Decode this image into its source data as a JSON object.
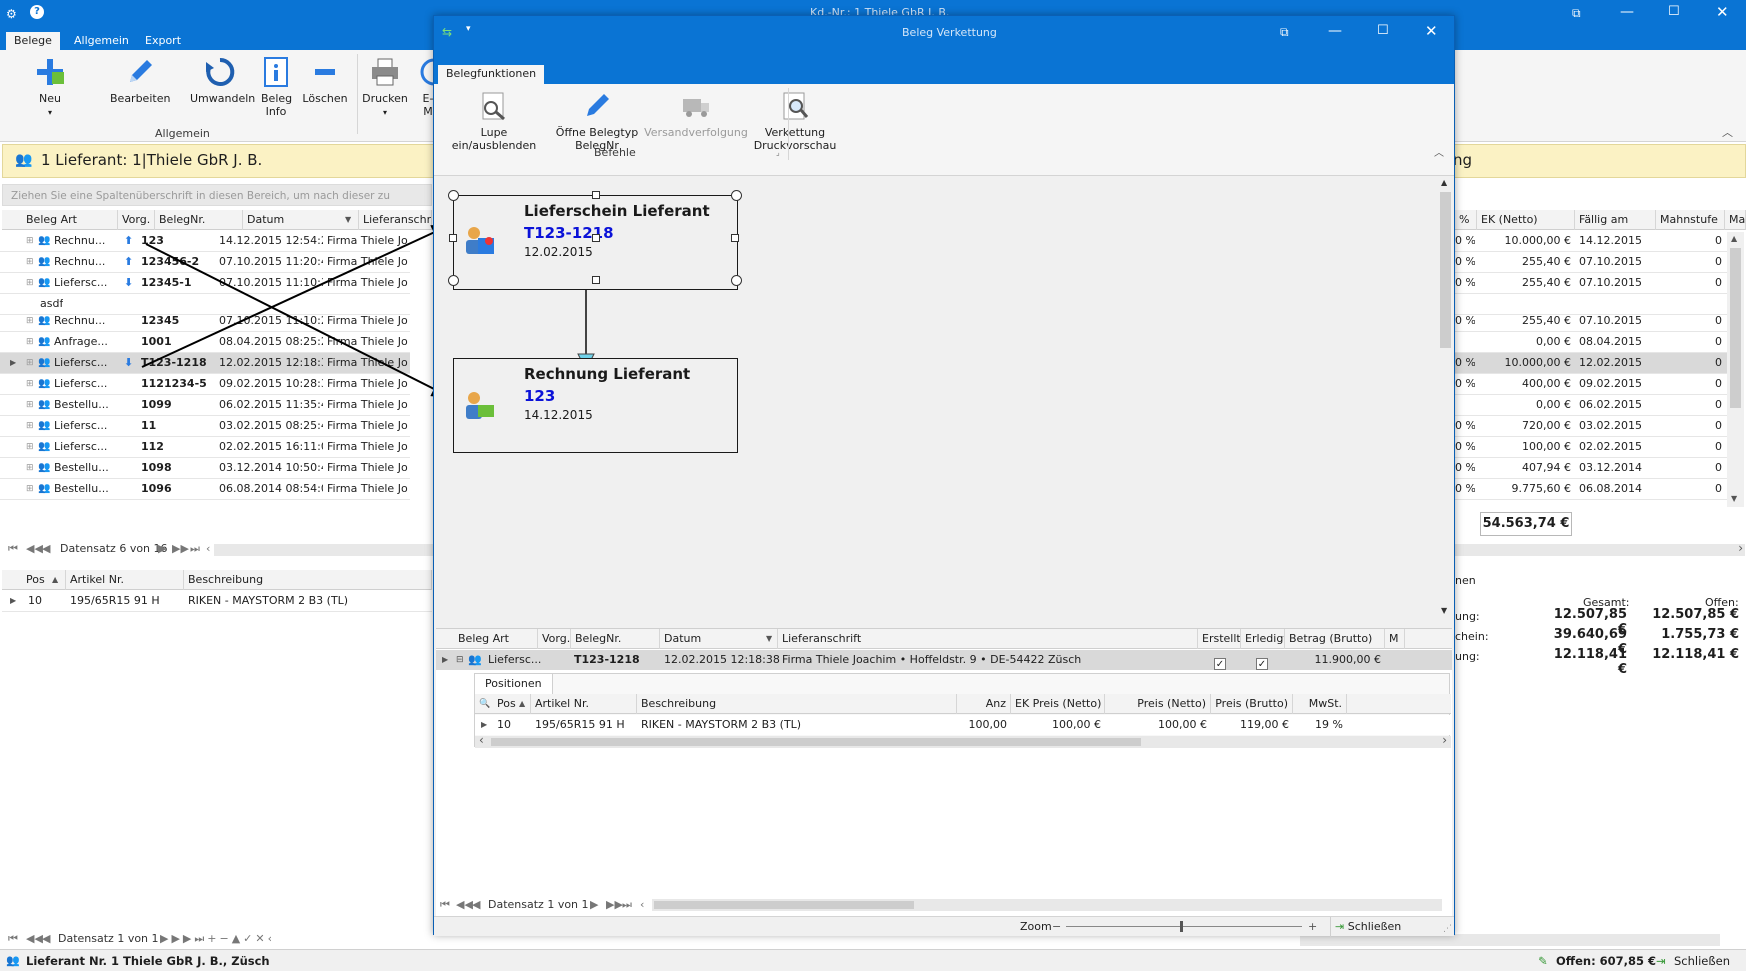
{
  "app": {
    "title": "Kd.-Nr.: 1 Thiele GbR J. B.",
    "tabs": [
      "Belege",
      "Allgemein",
      "Export"
    ],
    "ribbon": {
      "buttons": [
        "Neu",
        "Bearbeiten",
        "Umwandeln",
        "Beleg Info",
        "Löschen",
        "Drucken",
        "E-M"
      ],
      "group_label": "Allgemein"
    },
    "header_title": "1 Lieferant: 1|Thiele GbR J. B.",
    "header_right_fragment": "ng",
    "group_hint": "Ziehen Sie eine Spaltenüberschrift in diesen Bereich, um nach dieser zu gruppieren",
    "grid": {
      "columns": [
        "Beleg Art",
        "Vorg.",
        "BelegNr.",
        "Datum",
        "Lieferanschrift"
      ],
      "right_columns": [
        "%",
        "EK (Netto)",
        "Fällig am",
        "Mahnstufe",
        "Mah"
      ],
      "rows": [
        {
          "art": "Rechnu...",
          "vorg": "up",
          "nr": "123",
          "datum": "14.12.2015 12:54:25",
          "anschrift": "Firma Thiele Jo",
          "pct": "0 %",
          "ek": "10.000,00 €",
          "faellig": "14.12.2015",
          "mahn": "0"
        },
        {
          "art": "Rechnu...",
          "vorg": "up",
          "nr": "123456-2",
          "datum": "07.10.2015 11:20:40",
          "anschrift": "Firma Thiele Jo",
          "pct": "0 %",
          "ek": "255,40 €",
          "faellig": "07.10.2015",
          "mahn": "0"
        },
        {
          "art": "Liefersc...",
          "vorg": "down",
          "nr": "12345-1",
          "datum": "07.10.2015 11:10:32",
          "anschrift": "Firma Thiele Jo",
          "pct": "0 %",
          "ek": "255,40 €",
          "faellig": "07.10.2015",
          "mahn": "0"
        },
        {
          "art": "asdf",
          "vorg": "",
          "nr": "",
          "datum": "",
          "anschrift": "",
          "pct": "",
          "ek": "",
          "faellig": "",
          "mahn": "",
          "note": true
        },
        {
          "art": "Rechnu...",
          "vorg": "",
          "nr": "12345",
          "datum": "07.10.2015 11:10:20",
          "anschrift": "Firma Thiele Jo",
          "pct": "0 %",
          "ek": "255,40 €",
          "faellig": "07.10.2015",
          "mahn": "0"
        },
        {
          "art": "Anfrage...",
          "vorg": "",
          "nr": "1001",
          "datum": "08.04.2015 08:25:25",
          "anschrift": "Firma Thiele Jo",
          "pct": "",
          "ek": "0,00 €",
          "faellig": "08.04.2015",
          "mahn": "0"
        },
        {
          "art": "Liefersc...",
          "vorg": "down",
          "nr": "T123-1218",
          "datum": "12.02.2015 12:18:38",
          "anschrift": "Firma Thiele Jo",
          "pct": "0 %",
          "ek": "10.000,00 €",
          "faellig": "12.02.2015",
          "mahn": "0",
          "selected": true
        },
        {
          "art": "Liefersc...",
          "vorg": "",
          "nr": "1121234-5",
          "datum": "09.02.2015 10:28:34",
          "anschrift": "Firma Thiele Jo",
          "pct": "0 %",
          "ek": "400,00 €",
          "faellig": "09.02.2015",
          "mahn": "0"
        },
        {
          "art": "Bestellu...",
          "vorg": "",
          "nr": "1099",
          "datum": "06.02.2015 11:35:45",
          "anschrift": "Firma Thiele Jo",
          "pct": "",
          "ek": "0,00 €",
          "faellig": "06.02.2015",
          "mahn": "0"
        },
        {
          "art": "Liefersc...",
          "vorg": "",
          "nr": "11",
          "datum": "03.02.2015 08:25:45",
          "anschrift": "Firma Thiele Jo",
          "pct": "0 %",
          "ek": "720,00 €",
          "faellig": "03.02.2015",
          "mahn": "0"
        },
        {
          "art": "Liefersc...",
          "vorg": "",
          "nr": "112",
          "datum": "02.02.2015 16:11:08",
          "anschrift": "Firma Thiele Jo",
          "pct": "0 %",
          "ek": "100,00 €",
          "faellig": "02.02.2015",
          "mahn": "0"
        },
        {
          "art": "Bestellu...",
          "vorg": "",
          "nr": "1098",
          "datum": "03.12.2014 10:50:42",
          "anschrift": "Firma Thiele Jo",
          "pct": "0 %",
          "ek": "407,94 €",
          "faellig": "03.12.2014",
          "mahn": "0"
        },
        {
          "art": "Bestellu...",
          "vorg": "",
          "nr": "1096",
          "datum": "06.08.2014 08:54:09",
          "anschrift": "Firma Thiele Jo",
          "pct": "0 %",
          "ek": "9.775,60 €",
          "faellig": "06.08.2014",
          "mahn": "0"
        }
      ],
      "total": "54.563,74 €",
      "nav_text": "Datensatz 6 von 16"
    },
    "positions_grid": {
      "columns": [
        "Pos",
        "Artikel Nr.",
        "Beschreibung"
      ],
      "row": {
        "pos": "10",
        "artikel": "195/65R15 91 H",
        "beschreibung": "RIKEN - MAYSTORM 2 B3 (TL)"
      },
      "nav_text": "Datensatz 1 von 1"
    },
    "summary": {
      "section_fragment": "nen",
      "col_gesamt": "Gesamt:",
      "col_offen": "Offen:",
      "rows": [
        {
          "label": "ung:",
          "gesamt": "12.507,85 €",
          "offen": "12.507,85 €"
        },
        {
          "label": "chein:",
          "gesamt": "39.640,69 €",
          "offen": "1.755,73 €"
        },
        {
          "label": "ung:",
          "gesamt": "12.118,41 €",
          "offen": "12.118,41 €"
        }
      ]
    },
    "status": {
      "left": "Lieferant Nr. 1 Thiele GbR J. B., Züsch",
      "offen": "Offen: 607,85 €",
      "close": "Schließen"
    }
  },
  "dialog": {
    "title": "Beleg Verkettung",
    "tab": "Belegfunktionen",
    "buttons": [
      "Lupe ein/ausblenden",
      "Öffne Belegtyp BelegNr",
      "Versandverfolgung",
      "Verkettung Druckvorschau"
    ],
    "button_lines": [
      [
        "Lupe ein/ausblenden"
      ],
      [
        "Öffne Belegtyp",
        "BelegNr"
      ],
      [
        "Versandverfolgung"
      ],
      [
        "Verkettung",
        "Druckvorschau"
      ]
    ],
    "group_label": "Befehle",
    "nodes": [
      {
        "title": "Lieferschein Lieferant",
        "number": "T123-1218",
        "date": "12.02.2015"
      },
      {
        "title": "Rechnung Lieferant",
        "number": "123",
        "date": "14.12.2015"
      }
    ],
    "grid": {
      "columns": [
        "Beleg Art",
        "Vorg.",
        "BelegNr.",
        "Datum",
        "Lieferanschrift",
        "Erstellt",
        "Erledigt",
        "Betrag (Brutto)",
        "M"
      ],
      "row": {
        "art": "Liefersc...",
        "nr": "T123-1218",
        "datum": "12.02.2015 12:18:38",
        "anschrift": "Firma Thiele Joachim • Hoffeldstr. 9 • DE-54422 Züsch",
        "betrag": "11.900,00 €"
      },
      "subtab": "Positionen",
      "sub_columns": [
        "Pos",
        "Artikel Nr.",
        "Beschreibung",
        "Anz",
        "EK Preis (Netto)",
        "Preis (Netto)",
        "Preis (Brutto)",
        "MwSt."
      ],
      "sub_row": {
        "pos": "10",
        "artikel": "195/65R15 91 H",
        "beschreibung": "RIKEN - MAYSTORM 2 B3 (TL)",
        "anz": "100,00",
        "ek": "100,00 €",
        "netto": "100,00 €",
        "brutto": "119,00 €",
        "mwst": "19 %"
      },
      "nav_text": "Datensatz 1 von 1"
    },
    "zoom_label": "Zoom",
    "close_label": "Schließen"
  },
  "colors": {
    "accent": "#0a74d4",
    "header_yellow": "#fbf2c4",
    "link_blue": "#0b12d8"
  }
}
